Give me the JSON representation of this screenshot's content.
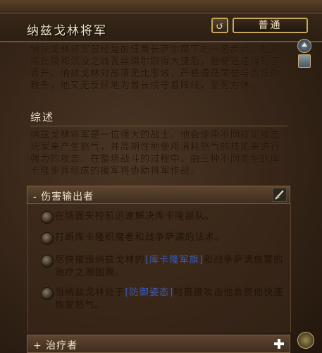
{
  "header": {
    "title": "纳兹戈林将军",
    "difficulty": "普通",
    "reset_glyph": "↺"
  },
  "intro": "纳兹戈林将军曾经是前任酋长萨尔麾下的一名步兵，在灰熊丘陵和沉没之城瓦丝琪尔取得大捷后，他便迅速得到了晋升。纳兹戈林对部落无比忠诚，严格遵循荣誉与责任的教条，他又无反顾地为酋长戍守着阵线，至死方休。",
  "overview": {
    "title": "综述",
    "text": "纳兹戈林将军是一位强大的战士。他会使用不同技能攻击玩家来产生怒气，并周期性地使用消耗怒气的技能来进行强力的攻击。在整场战斗的过程中，由三种不同类型的库卡隆步兵组成的援军将协助将军作战。"
  },
  "dps": {
    "label": "- 伤害输出者",
    "icon": "sword-icon",
    "items": [
      {
        "text": "在场面失控前迅速解决库卡隆部队。"
      },
      {
        "text": "打断库卡隆织魔者和战争萨满的法术。"
      },
      {
        "pre": "尽快摧毁纳兹戈林的",
        "link": "[库卡隆军旗]",
        "post": "和战争萨满放置的治疗之潮图腾。"
      },
      {
        "pre": "当纳兹戈林处于",
        "link": "[防御姿态]",
        "post": "时直接攻击他会使他快速恢复怒气。"
      }
    ]
  },
  "healer": {
    "label": "+ 治疗者",
    "icon": "plus-icon"
  },
  "colors": {
    "title_text": "#f2e4c8",
    "body_text": "#241409",
    "link": "#3a5ab8",
    "border_gold": "#c8a65a"
  }
}
